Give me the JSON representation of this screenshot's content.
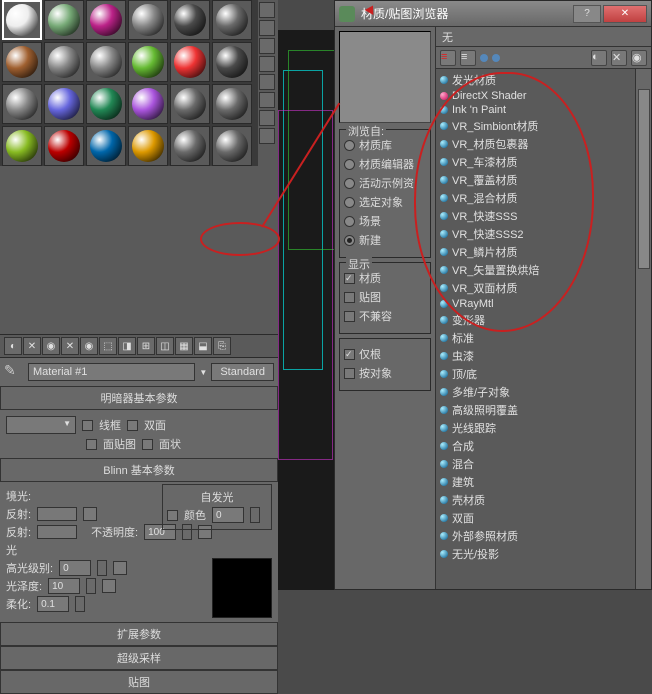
{
  "browser": {
    "title": "材质/贴图浏览器",
    "none_label": "无",
    "browse_from": {
      "title": "浏览自:",
      "options": [
        "材质库",
        "材质编辑器",
        "活动示例资",
        "选定对象",
        "场景",
        "新建"
      ]
    },
    "show": {
      "title": "显示",
      "items": [
        {
          "label": "材质",
          "checked": true
        },
        {
          "label": "贴图",
          "checked": false
        },
        {
          "label": "不兼容",
          "checked": false
        }
      ]
    },
    "show2": {
      "items": [
        {
          "label": "仅根",
          "checked": true
        },
        {
          "label": "按对象",
          "checked": false
        }
      ]
    },
    "materials": [
      "发光材质",
      "DirectX Shader",
      "Ink 'n Paint",
      "VR_Simbiont材质",
      "VR_材质包裹器",
      "VR_车漆材质",
      "VR_覆盖材质",
      "VR_混合材质",
      "VR_快速SSS",
      "VR_快速SSS2",
      "VR_鳞片材质",
      "VR_矢量置换烘焙",
      "VR_双面材质",
      "VRayMtl",
      "变形器",
      "标准",
      "虫漆",
      "顶/底",
      "多维/子对象",
      "高级照明覆盖",
      "光线跟踪",
      "合成",
      "混合",
      "建筑",
      "壳材质",
      "双面",
      "外部参照材质",
      "无光/投影"
    ]
  },
  "editor": {
    "material_name": "Material #1",
    "standard_btn": "Standard",
    "rollouts": {
      "shader": "明暗器基本参数",
      "blinn": "Blinn 基本参数",
      "ext": "扩展参数",
      "ss": "超级采样",
      "maps": "贴图"
    },
    "shader_params": {
      "wire": "线框",
      "two_side": "双面",
      "face_map": "面贴图",
      "face_status": "面状"
    },
    "blinn": {
      "self_illum": "自发光",
      "color_chk": "颜色",
      "color_val": "0",
      "ambient": "境光:",
      "diffuse": "反射:",
      "specular": "反射:",
      "opacity": "不透明度:",
      "opacity_val": "100",
      "spec_section": "光",
      "spec_level": "高光级别:",
      "spec_level_val": "0",
      "gloss": "光泽度:",
      "gloss_val": "10",
      "soften": "柔化:",
      "soften_val": "0.1"
    }
  },
  "sphere_colors": [
    "#eee",
    "#7a7",
    "#b28",
    "#888",
    "#4a4a4a",
    "#6a6a6a",
    "#a06030",
    "#888",
    "#888",
    "#6b3",
    "#e33",
    "#4a4a4a",
    "#888",
    "#66d",
    "#285",
    "#a5d",
    "#6a6a6a",
    "#6a6a6a",
    "#8b2",
    "#b00",
    "#06a",
    "#d90",
    "#6a6a6a",
    "#6a6a6a"
  ]
}
